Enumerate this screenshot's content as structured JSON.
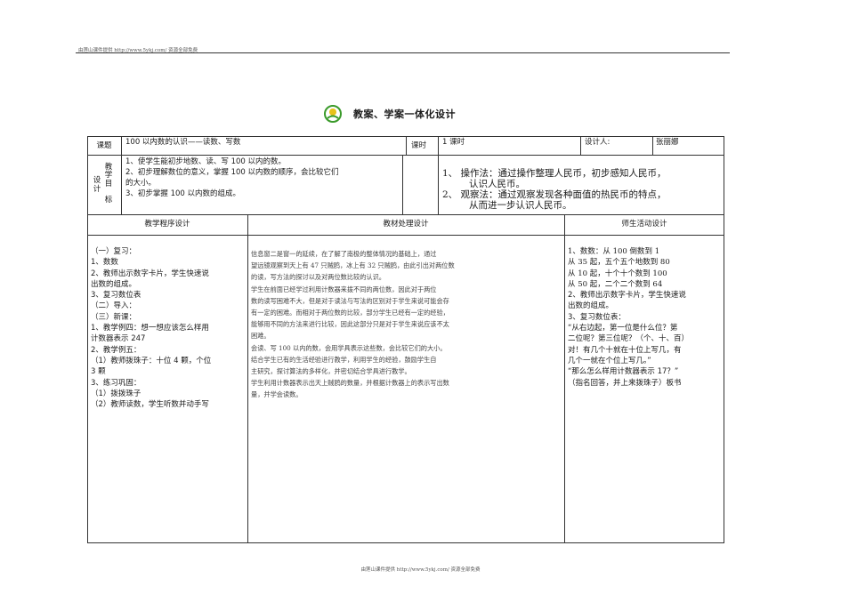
{
  "header": {
    "source": "由莲山课件提供 http://www.5ykj.com/   资源全部免费"
  },
  "footer": {
    "source": "由莲山课件提供 http://www.5ykj.com/   资源全部免费"
  },
  "doc_title": "教案、学案一体化设计",
  "info_row": {
    "topic_label": "课题",
    "topic_value": "100 以内数的认识——读数、写数",
    "hours_label": "课时",
    "hours_value": "1 课时",
    "designer_label": "设计人:",
    "designer_value": "张丽娜"
  },
  "goals": {
    "label": [
      "教",
      "学",
      "设",
      "计",
      "目",
      "标"
    ],
    "items": [
      "1、使学生能初步地数、读、写 100 以内的数。",
      "2、初步理解数位的意义，掌握 100 以内数的顺序，会比较它们",
      "的大小。",
      "3、初步掌握 100 以内数的组成。"
    ],
    "methods": [
      "1、  操作法：通过操作整理人民币，初步感知人民币，",
      "认识人民币。",
      "2、  观察法：通过观察发现各种面值的热民币的特点，",
      "从而进一步认识人民币。"
    ]
  },
  "columns": {
    "c1": "教学程序设计",
    "c2": "教材处理设计",
    "c3": "师生活动设计"
  },
  "procedure": [
    "（一）复习：",
    "1、数数",
    "2、教师出示数字卡片，学生快速说",
    "出数的组成。",
    "3、复习数位表",
    "（二）导入：",
    "（三）新课：",
    "1、教学例四：想一想应该怎么样用",
    "计数器表示 247",
    "2、教学例五：",
    "（1）教师拨珠子：十位 4 颗，个位",
    "3 颗",
    "3、练习巩固：",
    "（1）拨拨珠子",
    "（2）教师读数，学生听数并动手写"
  ],
  "material": [
    "    信息窗二是窗一的延续，在了解了南极的整体情况的基础上，通过",
    "望远镜观察到天上有 47 只贼鸥，冰上有 32 只贼鸥，由此引出对两位数",
    "的读，写方法的探讨以及对两位数比较的认识。",
    "    学生在前面已经学过利用计数器来拨不同的两位数，因此对于两位",
    "数的读写困难不大，但是对于读法与写法的区别对于学生来说可能会存",
    "有一定的困难。而相对于两位数的比较，部分学生已经有一定的经验，",
    "能够用不同的方法来进行比较，因此这部分只是对于学生来说应该不太",
    "困难。",
    "    会读、写 100 以内的数，会用学具表示这些数，会比较它们的大小。",
    "    结合学生已有的生活经验进行教学，利用学生的经验，鼓励学生自",
    "主研究，探讨算法的多样化，并密切结合学具进行教学。",
    "学生利用计数器表示出天上贼鸥的数量，并根据计数器上的表示写出数",
    "量，并学会读数。"
  ],
  "activity": [
    "1、数数：从 100 倒数到 1",
    "      从 35 起，五个五个地数到 80",
    "      从 10 起，十个十个数到 100",
    "      从 50 起，二个二个数到 64",
    "2、教师出示数字卡片，学生快速说",
    "出数的组成。",
    "3、复习数位表：",
    " “从右边起，第一位是什么位？第",
    "二位呢？第三位呢？（个、十、百）",
    "对！有几个十就在十位上写几，有",
    "几个一就在个位上写几。”",
    " “那么怎么样用计数器表示 17？”",
    "（指名回答，并上来拨珠子）板书"
  ],
  "colors": {
    "border": "#333333",
    "logo_green": "#3a9a2a",
    "logo_yellow": "#e8c21a"
  }
}
